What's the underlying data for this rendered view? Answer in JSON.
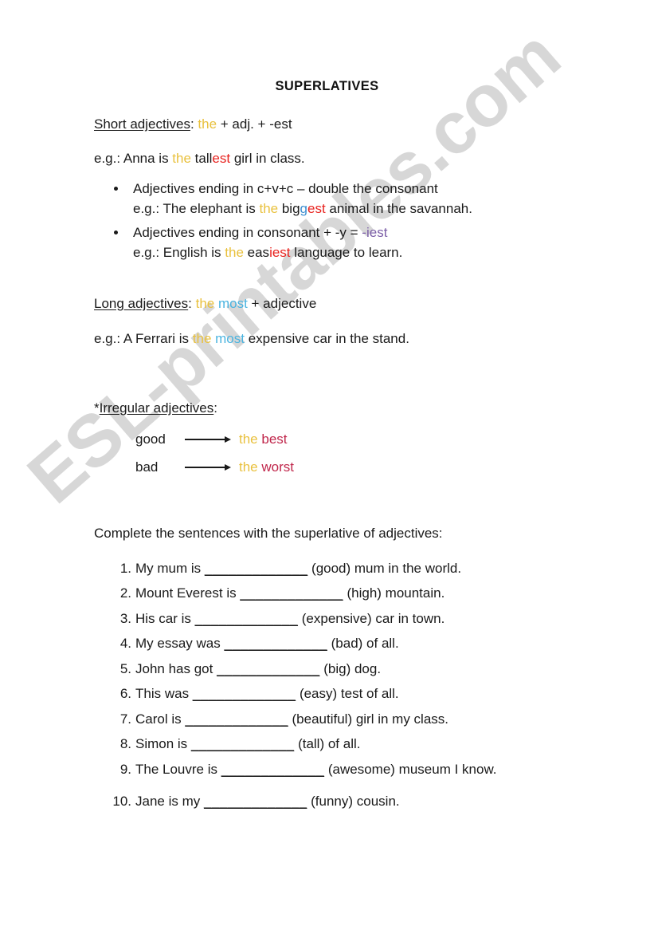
{
  "document": {
    "title": "SUPERLATIVES",
    "watermark": "ESL-printables.com"
  },
  "colors": {
    "gold": "#e9c13e",
    "red": "#e8231f",
    "cyan": "#4bb4e0",
    "purple": "#7b5ea7",
    "crimson": "#c0264b",
    "blue": "#3d8fd1",
    "text": "#1a1a1a"
  },
  "short_adjectives": {
    "heading_underlined": "Short adjectives",
    "heading_rest": ": ",
    "rule_the": "the",
    "rule_tail": " + adj. + -est",
    "example_prefix": "e.g.: Anna is ",
    "example_the": "the",
    "example_word_stem": " tall",
    "example_word_suffix": "est",
    "example_tail": " girl in class."
  },
  "bullets": [
    {
      "rule": "Adjectives ending in c+v+c – double the consonant",
      "eg_prefix": "e.g.: The elephant is ",
      "eg_the": "the",
      "eg_stem": " big",
      "eg_double": "g",
      "eg_suffix": "est",
      "eg_tail": " animal in the savannah."
    },
    {
      "rule_prefix": "Adjectives ending in consonant + -y = ",
      "rule_suffix": "-iest",
      "eg_prefix": "e.g.: English is ",
      "eg_the": "the",
      "eg_stem": " eas",
      "eg_suffix": "iest",
      "eg_tail": " language to learn."
    }
  ],
  "long_adjectives": {
    "heading_underlined": "Long adjectives",
    "heading_rest": ": ",
    "rule_the": "the",
    "rule_most": "most",
    "rule_tail": " + adjective",
    "example_prefix": "e.g.: A Ferrari is ",
    "example_the": "the",
    "example_most": "most",
    "example_tail": " expensive car in the stand."
  },
  "irregular_adjectives": {
    "heading_asterisk": "*",
    "heading_underlined": "Irregular adjectives",
    "heading_rest": ":",
    "rows": [
      {
        "base": "good",
        "the": "the",
        "form": "best"
      },
      {
        "base": "bad",
        "the": "the",
        "form": "worst"
      }
    ]
  },
  "exercise": {
    "prompt": "Complete the sentences with the superlative of adjectives:",
    "blank": "_____________",
    "questions": [
      {
        "num": "1.",
        "before": "My mum is ",
        "after": " (good) mum in the world."
      },
      {
        "num": "2.",
        "before": "Mount Everest is ",
        "after": " (high) mountain."
      },
      {
        "num": "3.",
        "before": "His car is ",
        "after": " (expensive) car in town."
      },
      {
        "num": "4.",
        "before": "My essay was ",
        "after": " (bad) of all."
      },
      {
        "num": "5.",
        "before": "John has got ",
        "after": " (big) dog."
      },
      {
        "num": "6.",
        "before": "This was ",
        "after": " (easy) test of all."
      },
      {
        "num": "7.",
        "before": "Carol is ",
        "after": " (beautiful) girl in my class."
      },
      {
        "num": "8.",
        "before": "Simon is ",
        "after": " (tall) of all."
      },
      {
        "num": "9.",
        "before": "The Louvre is ",
        "after": " (awesome) museum I know."
      },
      {
        "num": "10.",
        "before": "Jane is my ",
        "after": " (funny) cousin."
      }
    ]
  }
}
